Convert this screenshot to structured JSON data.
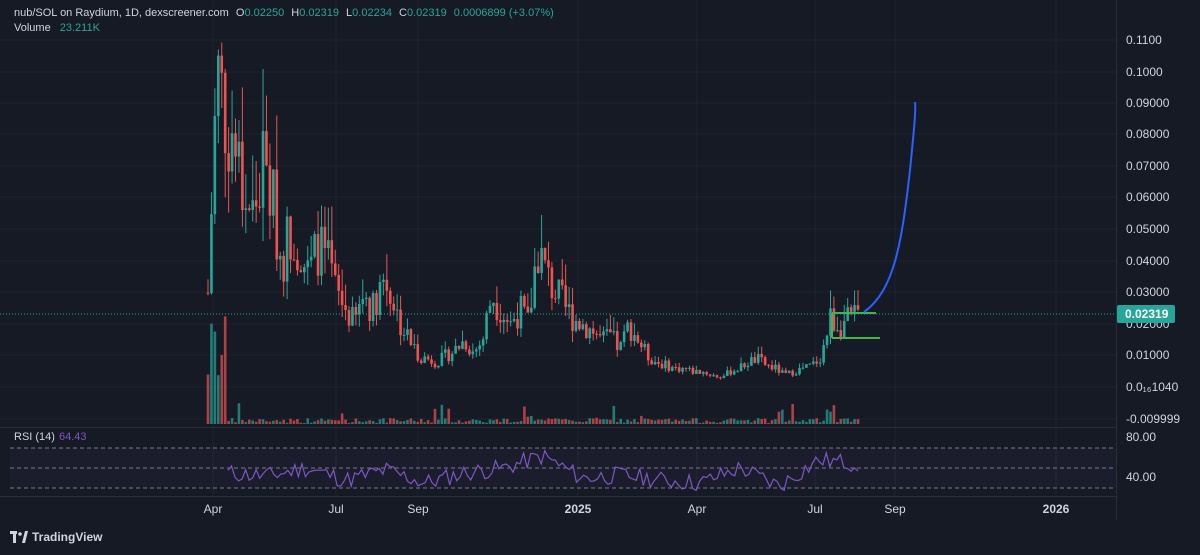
{
  "header": {
    "symbol": "nub/SOL on Raydium, 1D, dexscreener.com",
    "o_key": "O",
    "o": "0.02250",
    "h_key": "H",
    "h": "0.02319",
    "l_key": "L",
    "l": "0.02234",
    "c_key": "C",
    "c": "0.02319",
    "change": "0.0006899 (+3.07%)",
    "volume_label": "Volume",
    "volume": "23.211K"
  },
  "rsi": {
    "label": "RSI (14)",
    "value": "64.43"
  },
  "price_axis": [
    "0.1100",
    "0.1000",
    "0.09000",
    "0.08000",
    "0.07000",
    "0.06000",
    "0.05000",
    "0.04000",
    "0.03000",
    "0.02000",
    "0.01000",
    "0.0₁₆1040",
    "-0.009999"
  ],
  "last_price": "0.02319",
  "rsi_axis": [
    "80.00",
    "40.00"
  ],
  "time_axis": [
    "Apr",
    "Jul",
    "Sep",
    "2025",
    "Apr",
    "Jul",
    "Sep",
    "2026"
  ],
  "brand": "TradingView",
  "colors": {
    "bg": "#161a25",
    "up": "#26a69a",
    "down": "#ef5350",
    "rsi": "#7e57c2",
    "projection": "#2962ff",
    "box": "#4caf50"
  },
  "chart_data": [
    {
      "type": "line",
      "title": "nub/SOL on Raydium, 1D, dexscreener.com",
      "x": [
        "2024-03-28",
        "2024-04-01",
        "2024-04-07",
        "2024-04-14",
        "2024-04-21",
        "2024-04-28",
        "2024-05-05",
        "2024-05-12",
        "2024-05-19",
        "2024-05-26",
        "2024-06-02",
        "2024-06-09",
        "2024-06-16",
        "2024-06-23",
        "2024-06-30",
        "2024-07-07",
        "2024-07-14",
        "2024-07-21",
        "2024-07-28",
        "2024-08-04",
        "2024-08-11",
        "2024-08-18",
        "2024-08-25",
        "2024-09-01",
        "2024-09-08",
        "2024-09-15",
        "2024-09-22",
        "2024-09-29",
        "2024-10-06",
        "2024-10-13",
        "2024-10-20",
        "2024-10-27",
        "2024-11-03",
        "2024-11-10",
        "2024-11-17",
        "2024-11-24",
        "2024-12-01",
        "2024-12-08",
        "2024-12-15",
        "2024-12-22",
        "2024-12-29",
        "2025-01-05",
        "2025-01-12",
        "2025-01-19",
        "2025-01-26",
        "2025-02-02",
        "2025-02-09",
        "2025-02-16",
        "2025-02-23",
        "2025-03-02",
        "2025-03-09",
        "2025-03-16",
        "2025-03-23",
        "2025-03-30",
        "2025-04-06",
        "2025-04-13",
        "2025-04-20",
        "2025-04-27",
        "2025-05-04",
        "2025-05-11",
        "2025-05-18",
        "2025-05-25",
        "2025-06-01",
        "2025-06-08",
        "2025-06-15",
        "2025-06-22",
        "2025-06-29",
        "2025-07-06",
        "2025-07-13",
        "2025-07-20",
        "2025-07-27",
        "2025-08-03"
      ],
      "series": [
        {
          "values": [
            0.03,
            0.1,
            0.085,
            0.075,
            0.06,
            0.055,
            0.07,
            0.06,
            0.04,
            0.05,
            0.045,
            0.035,
            0.045,
            0.04,
            0.03,
            0.025,
            0.02,
            0.03,
            0.025,
            0.035,
            0.03,
            0.02,
            0.015,
            0.01,
            0.009,
            0.008,
            0.01,
            0.012,
            0.015,
            0.011,
            0.015,
            0.03,
            0.025,
            0.02,
            0.025,
            0.02,
            0.045,
            0.035,
            0.03,
            0.025,
            0.022,
            0.02,
            0.018,
            0.015,
            0.016,
            0.012,
            0.02,
            0.015,
            0.01,
            0.008,
            0.007,
            0.006,
            0.006,
            0.005,
            0.005,
            0.004,
            0.003,
            0.005,
            0.006,
            0.008,
            0.009,
            0.007,
            0.006,
            0.004,
            0.005,
            0.006,
            0.007,
            0.01,
            0.022,
            0.02,
            0.021,
            0.023
          ]
        }
      ],
      "ylim": [
        -0.01,
        0.115
      ]
    },
    {
      "type": "line",
      "title": "RSI (14)",
      "ylim": [
        30,
        90
      ],
      "x": [
        "2024-04",
        "2024-05",
        "2024-06",
        "2024-07",
        "2024-08",
        "2024-09",
        "2024-10",
        "2024-11",
        "2024-12",
        "2025-01",
        "2025-02",
        "2025-03",
        "2025-04",
        "2025-05",
        "2025-06",
        "2025-07",
        "2025-08"
      ],
      "series": [
        {
          "values": [
            55,
            52,
            60,
            48,
            58,
            45,
            55,
            60,
            72,
            50,
            53,
            48,
            45,
            60,
            42,
            68,
            64.43
          ]
        }
      ]
    }
  ]
}
